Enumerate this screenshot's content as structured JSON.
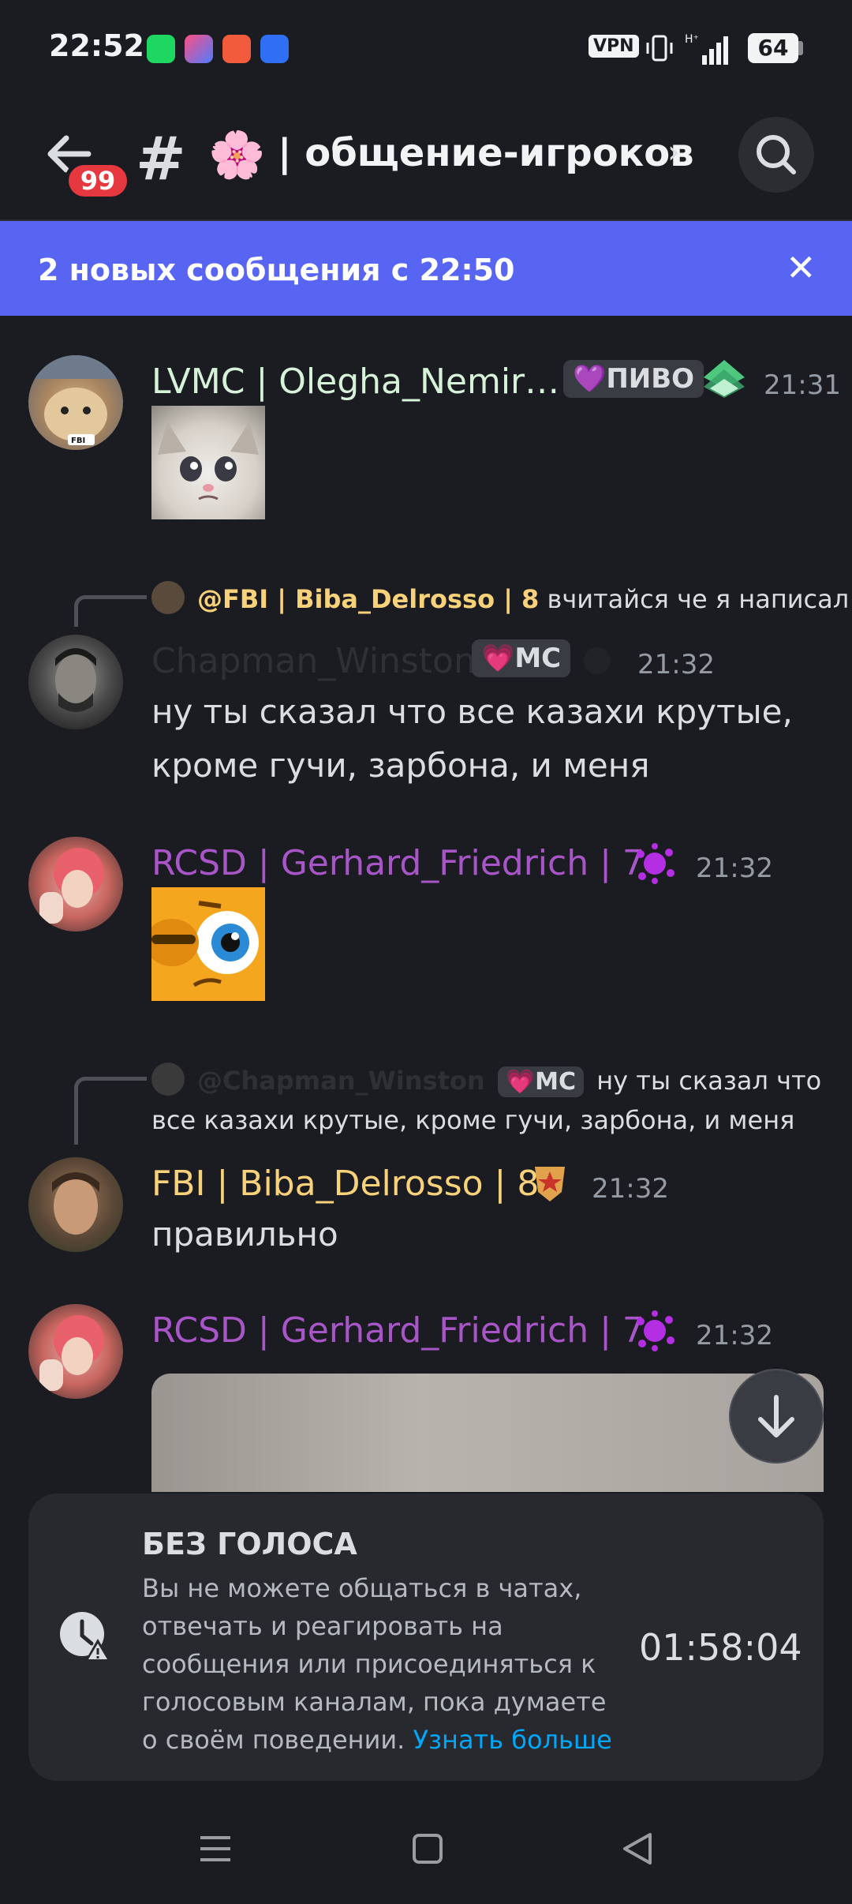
{
  "status": {
    "time": "22:52",
    "vpn": "VPN",
    "battery": "64"
  },
  "header": {
    "notification_badge": "99",
    "hash": "#",
    "channel_emoji": "🌸",
    "channel_name": "| общение-игроков",
    "chevron": "›"
  },
  "new_messages_bar": {
    "text": "2 новых сообщения с 22:50",
    "close": "✕"
  },
  "messages": [
    {
      "author": "LVMC | Olegha_Nemir…",
      "author_color": "#d6f2d8",
      "tag_emoji": "💜",
      "tag": "ПИВО",
      "time": "21:31",
      "attachment": "crying-cat-emoji"
    },
    {
      "reply_to_author": "@FBI | Biba_Delrosso | 8",
      "reply_to_text": "вчитайся че я написал",
      "author": "Chapman_Winston",
      "tag_emoji": "💗",
      "tag": "MC",
      "time": "21:32",
      "text_line1": "ну ты сказал что все казахи крутые,",
      "text_line2": "кроме гучи, зарбона, и меня"
    },
    {
      "author": "RCSD | Gerhard_Friedrich | 7",
      "author_color": "#a855c8",
      "time": "21:32",
      "attachment": "side-eye-emoji"
    },
    {
      "reply_to_author": "@Chapman_Winston",
      "reply_tag_emoji": "💗",
      "reply_tag": "MC",
      "reply_to_text_line1": "ну ты сказал что",
      "reply_to_text_line2": "все казахи крутые, кроме гучи, зарбона, и меня",
      "author": "FBI | Biba_Delrosso | 8",
      "author_color": "#f8d27a",
      "time": "21:32",
      "text_line1": "правильно"
    },
    {
      "author": "RCSD | Gerhard_Friedrich | 7",
      "author_color": "#a855c8",
      "time": "21:32",
      "attachment": "image"
    }
  ],
  "timeout_card": {
    "title": "БЕЗ ГОЛОСА",
    "body": "Вы не можете общаться в чатах, отвечать и реагировать на сообщения или присоединяться к голосовым каналам, пока думаете о своём поведении.",
    "link": "Узнать больше",
    "timer": "01:58:04"
  },
  "colors": {
    "background": "#1b1c21",
    "banner": "#5865f2",
    "badge": "#e5383f",
    "link": "#00a8fc"
  }
}
